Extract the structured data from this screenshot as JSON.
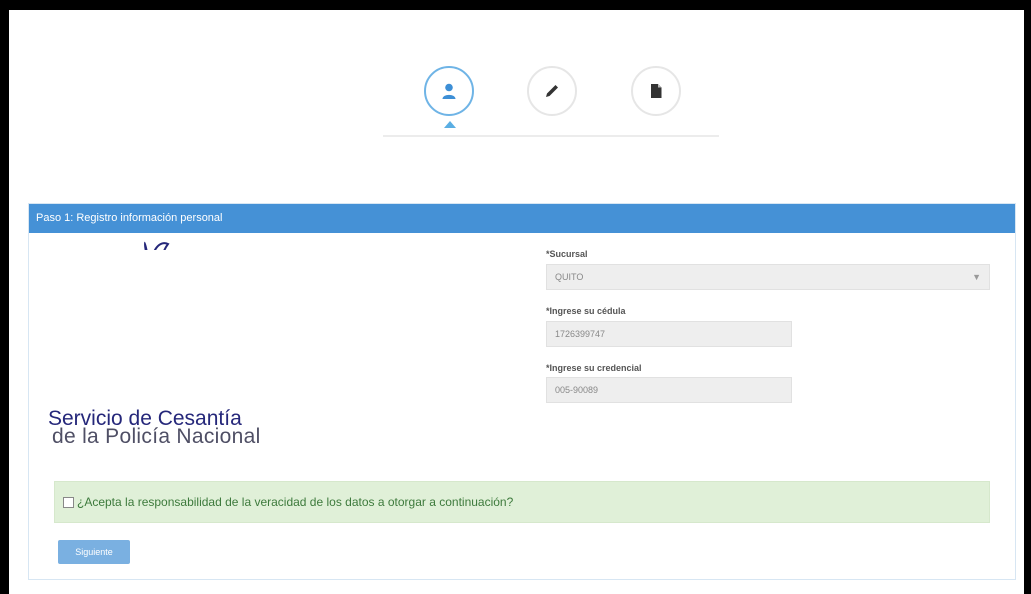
{
  "wizard": {
    "steps": [
      {
        "icon": "user-icon",
        "active": true
      },
      {
        "icon": "pencil-icon",
        "active": false
      },
      {
        "icon": "document-icon",
        "active": false
      }
    ]
  },
  "panel": {
    "header_title": "Paso 1: Registro información personal"
  },
  "logo": {
    "line1": "Servicio de Cesantía",
    "line2": "de la Policía Nacional"
  },
  "form": {
    "sucursal_label": "*Sucursal",
    "sucursal_value": "QUITO",
    "cedula_label": "*Ingrese su cédula",
    "cedula_value": "1726399747",
    "credencial_label": "*Ingrese su credencial",
    "credencial_value": "005-90089"
  },
  "consent": {
    "text": "¿Acepta la responsabilidad de la veracidad de los datos a otorgar a continuación?"
  },
  "actions": {
    "next_label": "Siguiente"
  },
  "colors": {
    "accent": "#4591d6",
    "alert_bg": "#e0f0d8",
    "logo_navy": "#25277a"
  }
}
